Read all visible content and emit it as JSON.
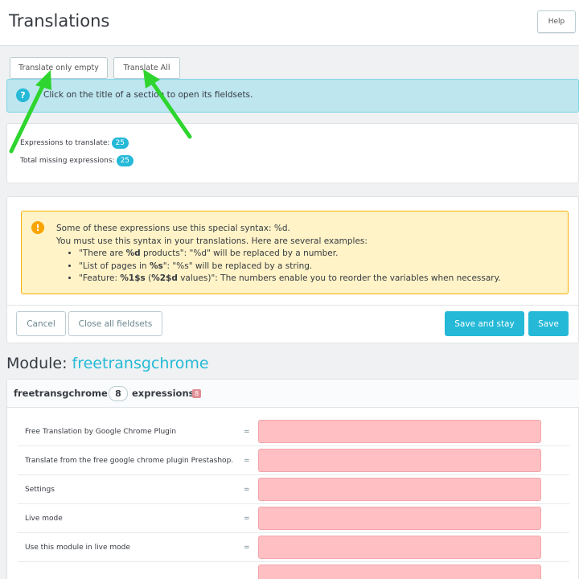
{
  "header": {
    "title": "Translations",
    "help_label": "Help"
  },
  "toolbar": {
    "translate_empty_label": "Translate only empty",
    "translate_all_label": "Translate All"
  },
  "info": {
    "icon": "question-circle-icon",
    "text": "Click on the title of a section to open its fieldsets."
  },
  "stats": {
    "to_translate_label": "Expressions to translate:",
    "to_translate_count": "25",
    "missing_label": "Total missing expressions:",
    "missing_count": "25"
  },
  "warning": {
    "icon": "exclamation-circle-icon",
    "line1": "Some of these expressions use this special syntax: %d.",
    "line2": "You must use this syntax in your translations. Here are several examples:",
    "ex1_pre": "\"There are ",
    "ex1_bold": "%d",
    "ex1_post": " products\": \"%d\" will be replaced by a number.",
    "ex2_pre": "\"List of pages in ",
    "ex2_bold": "%s",
    "ex2_post": "\": \"%s\" will be replaced by a string.",
    "ex3_pre": "\"Feature: ",
    "ex3_bold1": "%1$s",
    "ex3_mid": " (",
    "ex3_bold2": "%2$d",
    "ex3_post": " values)\": The numbers enable you to reorder the variables when necessary."
  },
  "actions": {
    "cancel": "Cancel",
    "close_all": "Close all fieldsets",
    "save_stay": "Save and stay",
    "save": "Save"
  },
  "module": {
    "title_prefix": "Module: ",
    "name": "freetransgchrome",
    "panel_name": "freetransgchrome",
    "count": "8",
    "expressions_label": "expressions",
    "missing": "8",
    "rows": [
      {
        "label": "Free Translation by Google Chrome Plugin",
        "eq": "=",
        "value": ""
      },
      {
        "label": "Translate from the free google chrome plugin Prestashop.",
        "eq": "=",
        "value": ""
      },
      {
        "label": "Settings",
        "eq": "=",
        "value": ""
      },
      {
        "label": "Live mode",
        "eq": "=",
        "value": ""
      },
      {
        "label": "Use this module in live mode",
        "eq": "=",
        "value": ""
      },
      {
        "label": "",
        "eq": "",
        "value": ""
      }
    ]
  },
  "colors": {
    "accent": "#25b9d7",
    "arrow": "#2ed52e",
    "missing_input": "#ffbfc3"
  }
}
